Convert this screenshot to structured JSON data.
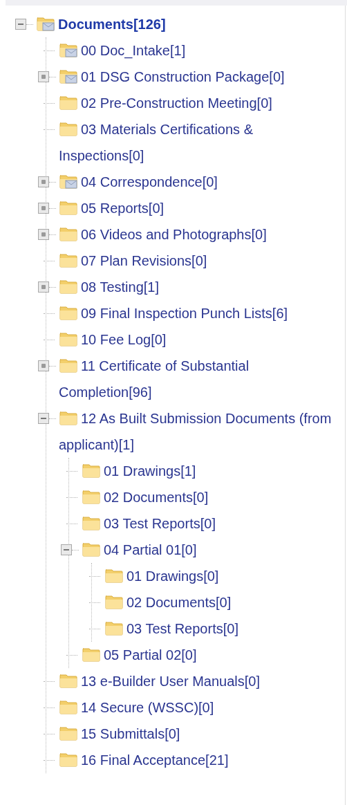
{
  "tree": [
    {
      "label": "Documents[126]",
      "kind": "mail",
      "expanded": true,
      "children": [
        {
          "label": "00 Doc_Intake[1]",
          "kind": "mail"
        },
        {
          "label": "01 DSG Construction Package[0]",
          "kind": "mail",
          "expanded": false
        },
        {
          "label": "02 Pre-Construction Meeting[0]",
          "kind": "plain"
        },
        {
          "label": "03 Materials Certifications & Inspections[0]",
          "kind": "plain"
        },
        {
          "label": "04 Correspondence[0]",
          "kind": "mail",
          "expanded": false
        },
        {
          "label": "05 Reports[0]",
          "kind": "plain",
          "expanded": false
        },
        {
          "label": "06 Videos and Photographs[0]",
          "kind": "plain",
          "expanded": false
        },
        {
          "label": "07 Plan Revisions[0]",
          "kind": "plain"
        },
        {
          "label": "08 Testing[1]",
          "kind": "plain",
          "expanded": false
        },
        {
          "label": "09 Final Inspection Punch Lists[6]",
          "kind": "plain"
        },
        {
          "label": "10 Fee Log[0]",
          "kind": "plain"
        },
        {
          "label": "11 Certificate of Substantial Completion[96]",
          "kind": "plain",
          "expanded": false
        },
        {
          "label": "12 As Built Submission Documents (from applicant)[1]",
          "kind": "plain",
          "expanded": true,
          "children": [
            {
              "label": "01 Drawings[1]",
              "kind": "plain"
            },
            {
              "label": "02 Documents[0]",
              "kind": "plain"
            },
            {
              "label": "03 Test Reports[0]",
              "kind": "plain"
            },
            {
              "label": "04 Partial 01[0]",
              "kind": "plain",
              "expanded": true,
              "children": [
                {
                  "label": "01 Drawings[0]",
                  "kind": "plain"
                },
                {
                  "label": "02 Documents[0]",
                  "kind": "plain"
                },
                {
                  "label": "03 Test Reports[0]",
                  "kind": "plain"
                }
              ]
            },
            {
              "label": "05 Partial 02[0]",
              "kind": "plain"
            }
          ]
        },
        {
          "label": "13 e-Builder User Manuals[0]",
          "kind": "plain"
        },
        {
          "label": "14 Secure (WSSC)[0]",
          "kind": "plain"
        },
        {
          "label": "15 Submittals[0]",
          "kind": "plain"
        },
        {
          "label": "16 Final Acceptance[21]",
          "kind": "plain"
        }
      ]
    }
  ]
}
